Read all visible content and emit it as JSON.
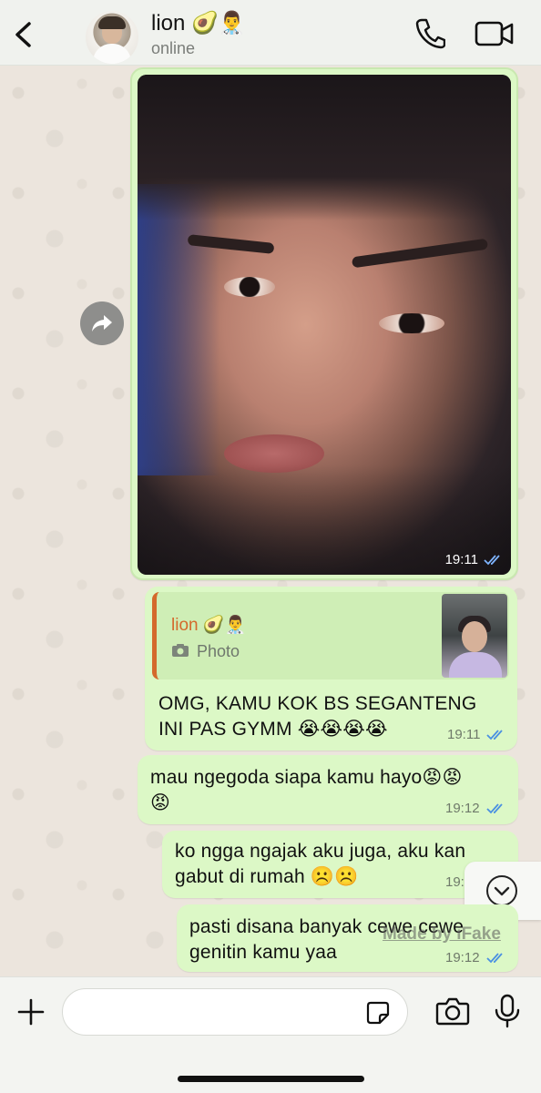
{
  "header": {
    "back_label": "back",
    "contact_name": "lion 🥑👨‍⚕️",
    "status": "online"
  },
  "messages": {
    "photo": {
      "time": "19:11"
    },
    "reply": {
      "quote_name": "lion 🥑👨‍⚕️",
      "quote_label": "Photo",
      "text_line1": "OMG, KAMU KOK BS SEGANTENG",
      "text_line2": "INI PAS GYMM 😭😭😭😭",
      "time": "19:11"
    },
    "m2": {
      "text_line1": "mau ngegoda siapa kamu hayo😡😡",
      "text_line2": "😡",
      "time": "19:12"
    },
    "m3": {
      "text_line1": "ko ngga ngajak aku juga, aku kan",
      "text_line2": "gabut di rumah ☹️☹️",
      "time": "19:12"
    },
    "m4": {
      "text_line1": "pasti disana banyak cewe cewe",
      "text_line2": "genitin kamu yaa",
      "time": "19:12"
    }
  },
  "watermark": "Made by iFake",
  "colors": {
    "bubble": "#dcf8c6",
    "tick_blue": "#4a90e2",
    "quote_accent": "#d4692c",
    "header_bg": "#f0f2ee"
  }
}
